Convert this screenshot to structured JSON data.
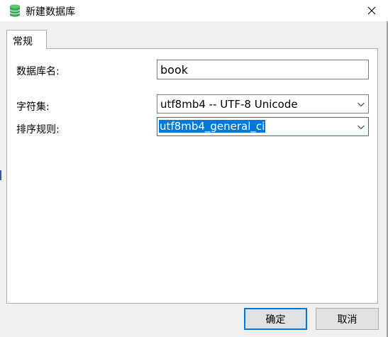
{
  "window": {
    "title": "新建数据库",
    "icon": "database-icon",
    "close_icon": "close-icon"
  },
  "tabs": [
    {
      "label": "常规",
      "active": true
    }
  ],
  "form": {
    "db_name_label": "数据库名:",
    "db_name_value": "book",
    "charset_label": "字符集:",
    "charset_value": "utf8mb4 -- UTF-8 Unicode",
    "collation_label": "排序规则:",
    "collation_value": "utf8mb4_general_ci"
  },
  "buttons": {
    "ok": "确定",
    "cancel": "取消"
  },
  "colors": {
    "accent": "#0078d7",
    "icon_green": "#3aa655",
    "dialog_bg": "#f0f0f0"
  }
}
